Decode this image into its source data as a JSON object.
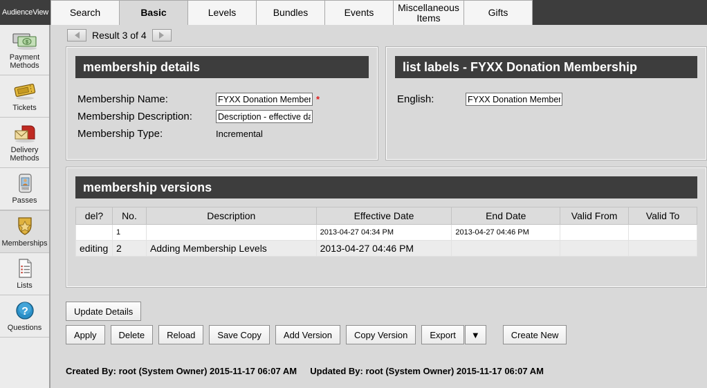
{
  "brand": {
    "name": "AudienceView"
  },
  "tabs": [
    {
      "label": "Search",
      "active": false,
      "name": "tab-search"
    },
    {
      "label": "Basic",
      "active": true,
      "name": "tab-basic"
    },
    {
      "label": "Levels",
      "active": false,
      "name": "tab-levels"
    },
    {
      "label": "Bundles",
      "active": false,
      "name": "tab-bundles"
    },
    {
      "label": "Events",
      "active": false,
      "name": "tab-events"
    },
    {
      "label": "Miscellaneous Items",
      "active": false,
      "name": "tab-miscellaneous-items"
    },
    {
      "label": "Gifts",
      "active": false,
      "name": "tab-gifts"
    }
  ],
  "sidebar": {
    "items": [
      {
        "label": "Payment Methods",
        "icon": "banknote-icon",
        "selected": false
      },
      {
        "label": "Tickets",
        "icon": "ticket-icon",
        "selected": false
      },
      {
        "label": "Delivery Methods",
        "icon": "mailbox-envelope-icon",
        "selected": false
      },
      {
        "label": "Passes",
        "icon": "pass-card-icon",
        "selected": false
      },
      {
        "label": "Memberships",
        "icon": "shield-star-icon",
        "selected": true
      },
      {
        "label": "Lists",
        "icon": "document-list-icon",
        "selected": false
      },
      {
        "label": "Questions",
        "icon": "question-circle-icon",
        "selected": false
      }
    ]
  },
  "result_nav": {
    "prev_icon": "left-arrow-icon",
    "next_icon": "right-arrow-icon",
    "text": "Result 3 of 4"
  },
  "membership_details": {
    "title": "membership details",
    "fields": {
      "name_label": "Membership Name:",
      "name_value": "FYXX Donation Membership",
      "name_required_marker": "*",
      "description_label": "Membership Description:",
      "description_value": "Description - effective date",
      "type_label": "Membership Type:",
      "type_value": "Incremental"
    }
  },
  "list_labels": {
    "title": "list labels - FYXX Donation Membership",
    "english_label": "English:",
    "english_value": "FYXX Donation Membership"
  },
  "membership_versions": {
    "title": "membership versions",
    "columns": [
      "del?",
      "No.",
      "Description",
      "Effective Date",
      "End Date",
      "Valid From",
      "Valid To"
    ],
    "rows": [
      {
        "del": "",
        "no": "1",
        "description": "",
        "effective_date": "2013-04-27 04:34 PM",
        "end_date": "2013-04-27 04:46 PM",
        "valid_from": "",
        "valid_to": ""
      },
      {
        "del": "editing",
        "no": "2",
        "description": "Adding Membership Levels",
        "effective_date": "2013-04-27 04:46 PM",
        "end_date": "",
        "valid_from": "",
        "valid_to": ""
      }
    ]
  },
  "actions": {
    "update_details": "Update Details",
    "apply": "Apply",
    "delete": "Delete",
    "reload": "Reload",
    "save_copy": "Save Copy",
    "add_version": "Add Version",
    "copy_version": "Copy Version",
    "export": "Export",
    "export_caret": "▼",
    "create_new": "Create New"
  },
  "footer": {
    "created": "Created By: root (System Owner) 2015-11-17 06:07 AM",
    "updated": "Updated By: root (System Owner) 2015-11-17 06:07 AM"
  },
  "colors": {
    "header_dark": "#3d3d3d",
    "page_bg": "#d9d9d9",
    "sidebar_bg": "#ececec",
    "required_red": "#e01b1b",
    "tab_inactive": "#f5f5f5"
  }
}
